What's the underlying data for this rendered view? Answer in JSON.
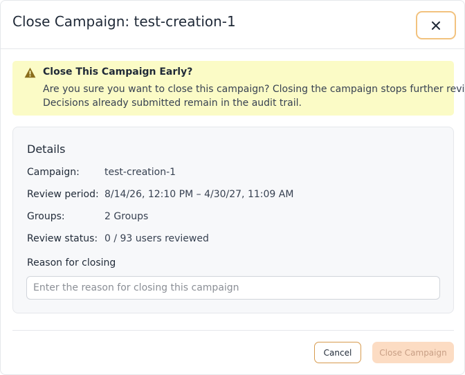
{
  "dialog": {
    "title": "Close Campaign: test-creation-1",
    "close_icon": "close-icon"
  },
  "warning": {
    "icon": "warning-triangle-icon",
    "icon_color": "#8a6d1c",
    "background": "#fbfbc6",
    "title": "Close This Campaign Early?",
    "line1": "Are you sure you want to close this campaign? Closing the campaign stops further reviews.",
    "line2": "Decisions already submitted remain in the audit trail."
  },
  "details": {
    "heading": "Details",
    "rows": [
      {
        "label": "Campaign:",
        "value": "test-creation-1"
      },
      {
        "label": "Review period:",
        "value": "8/14/26, 12:10 PM – 4/30/27, 11:09 AM"
      },
      {
        "label": "Groups:",
        "value": "2 Groups"
      },
      {
        "label": "Review status:",
        "value": "0 / 93 users reviewed"
      }
    ],
    "reason_label": "Reason for closing",
    "reason_placeholder": "Enter the reason for closing this campaign",
    "reason_value": ""
  },
  "footer": {
    "cancel_label": "Cancel",
    "confirm_label": "Close Campaign",
    "confirm_disabled": true
  },
  "colors": {
    "accent": "#d79a4d",
    "focus_ring": "#f2c27e",
    "confirm_disabled_bg": "#fcdcc3"
  }
}
